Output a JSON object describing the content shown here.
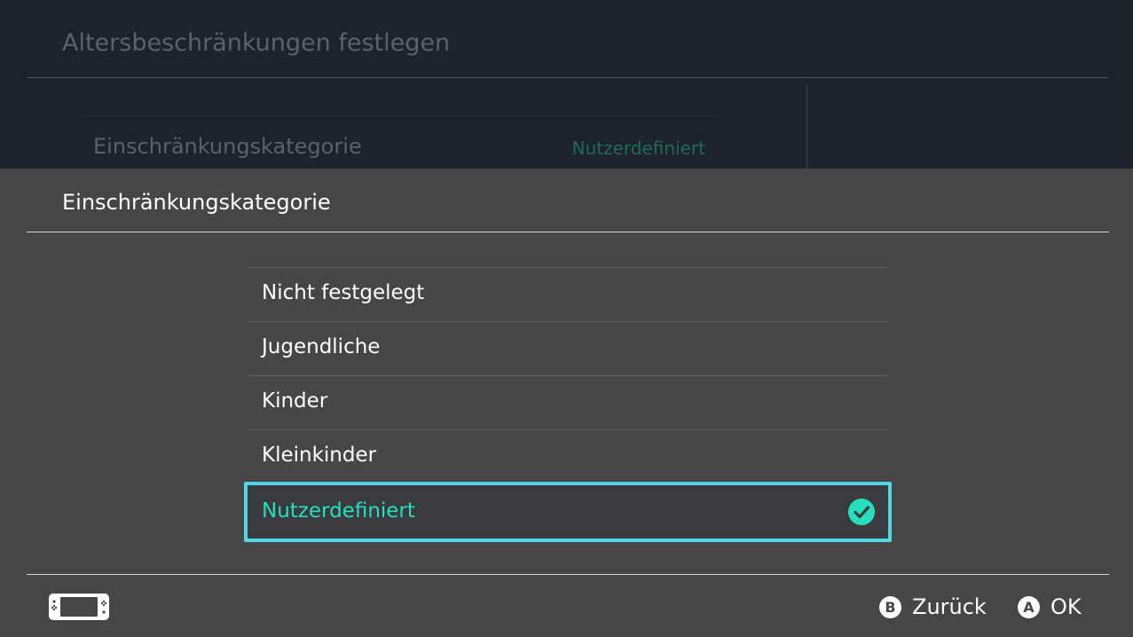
{
  "background": {
    "title": "Altersbeschränkungen festlegen",
    "row_label": "Einschränkungskategorie",
    "row_value": "Nutzerdefiniert"
  },
  "dialog": {
    "title": "Einschränkungskategorie",
    "options": [
      {
        "label": "Nicht festgelegt",
        "selected": false
      },
      {
        "label": "Jugendliche",
        "selected": false
      },
      {
        "label": "Kinder",
        "selected": false
      },
      {
        "label": "Kleinkinder",
        "selected": false
      },
      {
        "label": "Nutzerdefiniert",
        "selected": true
      }
    ]
  },
  "footer": {
    "console_icon": "handheld-console-icon",
    "back_button_glyph": "B",
    "back_label": "Zurück",
    "ok_button_glyph": "A",
    "ok_label": "OK"
  },
  "colors": {
    "accent": "#27dfbf",
    "focus_border": "#55d5e8",
    "panel_bg": "#464646",
    "page_bg": "#1d232a"
  }
}
